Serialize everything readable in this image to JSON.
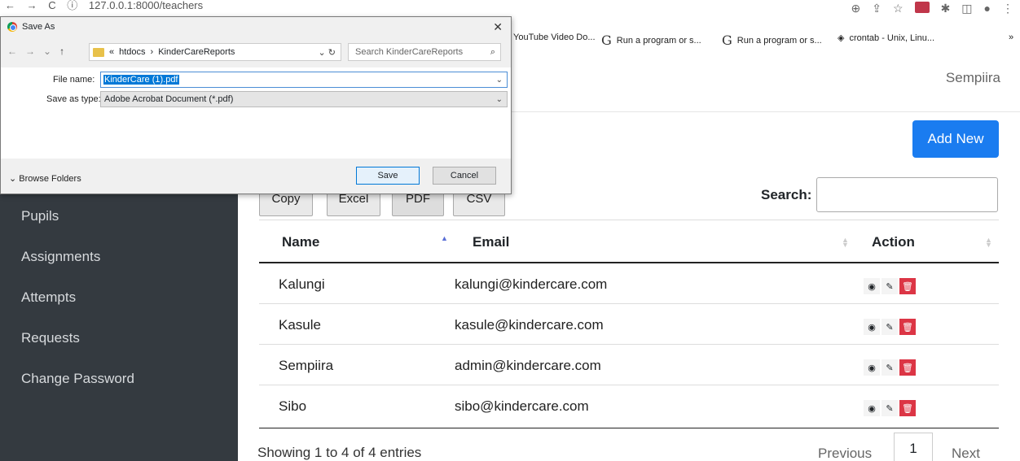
{
  "browser": {
    "url": "127.0.0.1:8000/teachers",
    "bookmarks": [
      {
        "label": "YouTube Video Do..."
      },
      {
        "label": "Run a program or s..."
      },
      {
        "label": "Run a program or s..."
      },
      {
        "label": "crontab - Unix, Linu..."
      }
    ],
    "more": "»"
  },
  "navbar": {
    "user_name": "Sempiira"
  },
  "sidebar": {
    "items": [
      {
        "label": "Pupils"
      },
      {
        "label": "Assignments"
      },
      {
        "label": "Attempts"
      },
      {
        "label": "Requests"
      },
      {
        "label": "Change Password"
      }
    ]
  },
  "main": {
    "add_new": "Add New",
    "export_buttons": [
      "Copy",
      "Excel",
      "PDF",
      "CSV"
    ],
    "search_label": "Search:",
    "columns": [
      "Name",
      "Email",
      "Action"
    ],
    "rows": [
      {
        "name": "Kalungi",
        "email": "kalungi@kindercare.com"
      },
      {
        "name": "Kasule",
        "email": "kasule@kindercare.com"
      },
      {
        "name": "Sempiira",
        "email": "admin@kindercare.com"
      },
      {
        "name": "Sibo",
        "email": "sibo@kindercare.com"
      }
    ],
    "showing": "Showing 1 to 4 of 4 entries",
    "pagination": {
      "previous": "Previous",
      "current": "1",
      "next": "Next"
    }
  },
  "dialog": {
    "title": "Save As",
    "close": "✕",
    "path_prefix": "«",
    "path": [
      "htdocs",
      "KinderCareReports"
    ],
    "search_placeholder": "Search KinderCareReports",
    "file_name_label": "File name:",
    "file_name": "KinderCare (1).pdf",
    "save_type_label": "Save as type:",
    "save_type": "Adobe Acrobat Document (*.pdf)",
    "browse_folders": "Browse Folders",
    "save": "Save",
    "cancel": "Cancel"
  },
  "colors": {
    "sidebar": "#343a40",
    "primary": "#1a7cf0",
    "danger": "#dc3545"
  }
}
